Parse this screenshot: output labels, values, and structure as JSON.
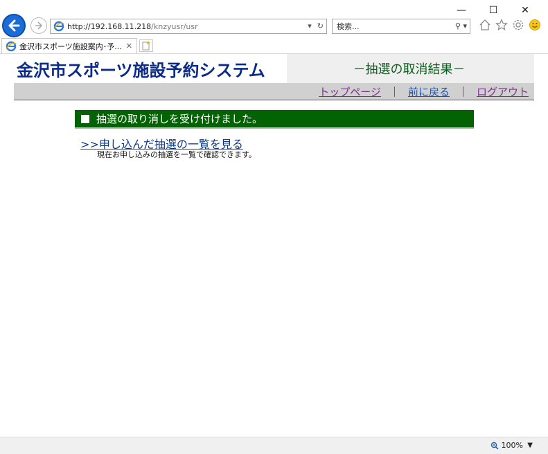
{
  "browser": {
    "address": {
      "host": "http://192.168.11.218",
      "path": "/knzyusr/usr"
    },
    "search_placeholder": "検索...",
    "tab_title": "金沢市スポーツ施設案内･予...",
    "zoom": "100%"
  },
  "site": {
    "logo_text": "金沢市スポーツ施設予約システム",
    "page_heading": "－抽選の取消結果－"
  },
  "nav": {
    "top_page": "トップページ",
    "back": "前に戻る",
    "logout": "ログアウト",
    "separator": "｜"
  },
  "notice": {
    "message": "抽選の取り消しを受け付けました。"
  },
  "link": {
    "label": ">>申し込んだ抽選の一覧を見る",
    "description": "現在お申し込みの抽選を一覧で確認できます。"
  },
  "colors": {
    "notice_bg": "#036303",
    "heading_green": "#0b5e1b",
    "logo_blue": "#0a2a8a"
  }
}
